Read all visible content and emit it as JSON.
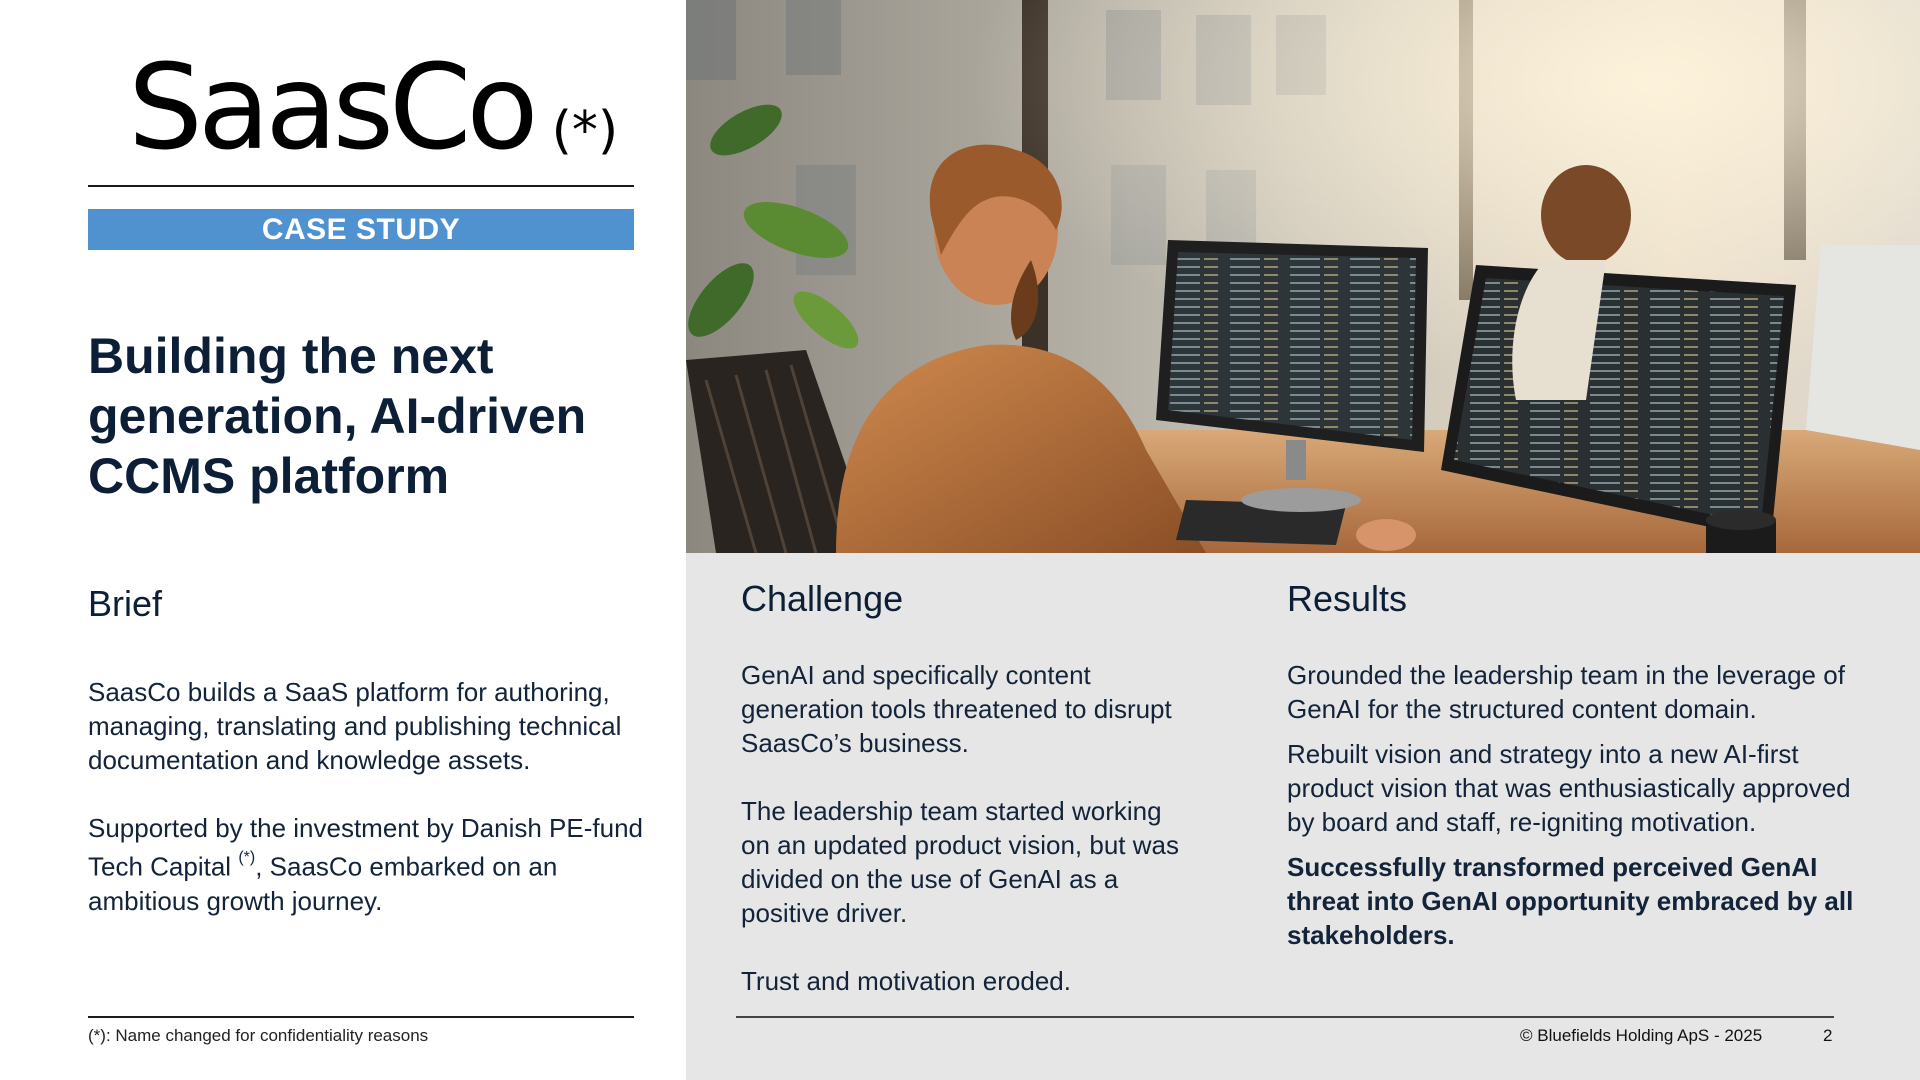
{
  "logo": {
    "name": "SaasCo",
    "mark": "(*)"
  },
  "banner": {
    "label": "CASE STUDY"
  },
  "headline": "Building the next generation, AI-driven CCMS platform",
  "brief": {
    "heading": "Brief",
    "p1": "SaasCo builds a SaaS platform for authoring, managing, translating and publishing technical documentation and knowledge assets.",
    "p2_before": "Supported by the investment by Danish PE-fund Tech Capital ",
    "p2_mark": "(*)",
    "p2_after": ", SaasCo embarked on an ambitious growth journey."
  },
  "footnote": "(*): Name changed for confidentiality reasons",
  "challenge": {
    "heading": "Challenge",
    "p1": "GenAI and specifically content generation tools threatened to disrupt SaasCo’s business.",
    "p2": "The leadership team started working on an updated product vision, but was divided on the use of GenAI as a positive driver.",
    "p3": "Trust and motivation eroded."
  },
  "results": {
    "heading": "Results",
    "p1": "Grounded the leadership team in the leverage of GenAI for the structured content domain.",
    "p2": "Rebuilt vision and strategy into a new AI-first product vision that was enthusiastically approved by board and staff, re-igniting motivation.",
    "p3": "Successfully transformed perceived GenAI threat into GenAI opportunity embraced by all stakeholders."
  },
  "footer": {
    "copyright": "© Bluefields Holding ApS - 2025",
    "page": "2"
  },
  "colors": {
    "banner": "#4f92cf",
    "text": "#0c1f36",
    "panel": "#e6e6e6"
  },
  "image": {
    "subject": "office-workers-coding-photo"
  }
}
